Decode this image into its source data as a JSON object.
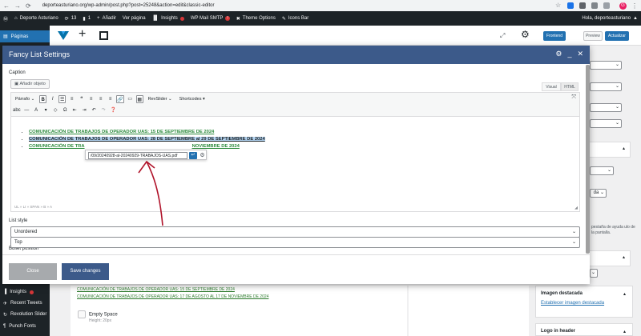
{
  "browser": {
    "url": "deporteasturiano.org/wp-admin/post.php?post=25248&action=edit&classic-editor"
  },
  "adminbar": {
    "site": "Deporte Asturiano",
    "updates": "13",
    "comments": "1",
    "add_new": "Añadir",
    "view_page": "Ver página",
    "insights": "Insights",
    "smtp": "WP Mail SMTP",
    "smtp_badge": "!",
    "theme_options": "Theme Options",
    "icons": "Icons Bar",
    "greeting": "Hola, deporteasturiano"
  },
  "sidebar": {
    "current": "Páginas",
    "items": [
      {
        "label": "Insights"
      },
      {
        "label": "Recent Tweets"
      },
      {
        "label": "Revolution Slider"
      },
      {
        "label": "Punch Fonts"
      }
    ]
  },
  "editor_bar": {
    "frontend": "Frontend",
    "preview": "Preview",
    "update": "Actualizar"
  },
  "modal": {
    "title": "Fancy List Settings",
    "caption_label": "Caption",
    "add_media": "Añadir objeto",
    "tab_visual": "Visual",
    "tab_html": "HTML",
    "format_select": "Párrafo",
    "revslider": "RevSlider",
    "shortcodes": "Shortcodes",
    "list_items": [
      "COMUNICACIÓN DE TRABAJOS DE OPERADOR UAS: 15 DE SEPTIEMBRE DE 2024",
      "COMUNICACIÓN DE TRABAJOS DE OPERADOR UAS: 28 DE SEPTIEMBRE al 29 DE SEPTIEMBRE DE 2024",
      "COMUNICACIÓN DE TRA",
      "NOVIEMBRE DE 2024"
    ],
    "link_url": "/09/20240928-al-20240929-TRABAJOS-UAS.pdf",
    "path": "UL » LI » SPAN » B » A",
    "list_style_label": "List style",
    "list_style_value": "Unordered",
    "bullet_position_label": "Bullet position",
    "bullet_position_value": "Top",
    "close": "Close",
    "save": "Save changes"
  },
  "behind": {
    "links": [
      "COMUNICACIÓN DE TRABAJOS DE OPERADOR UAS: 15 DE SEPTIEMBRE DE 2024",
      "COMUNICACIÓN DE TRABAJOS DE OPERADOR UAS: 17 DE AGOSTO AL 17 DE NOVIEMBRE DE 2024"
    ],
    "empty_space": "Empty Space",
    "empty_space_sub": "Height: 20px",
    "help_text": "pestaña de ayuda ulo de la pantalla.",
    "featured_image_title": "Imagen destacada",
    "featured_image_link": "Establecer imagen destacada",
    "logo_header_title": "Logo in header",
    "select_value": "da"
  }
}
